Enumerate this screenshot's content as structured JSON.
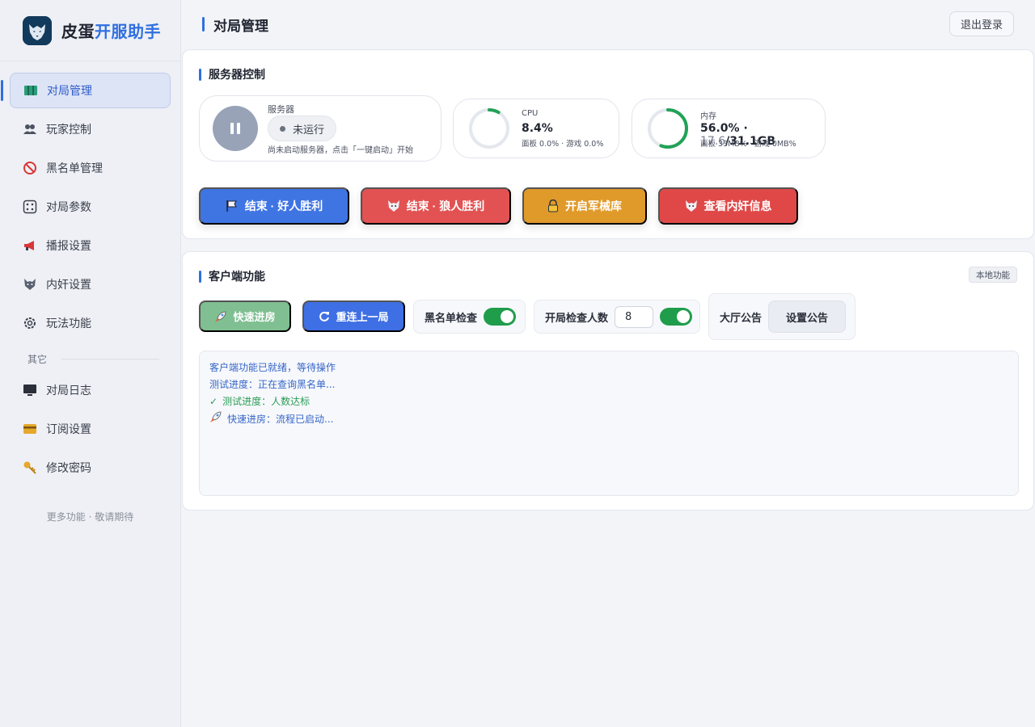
{
  "brand": {
    "name_prefix": "皮蛋",
    "name_accent": "开服助手",
    "logo_icon": "wolf-logo-icon"
  },
  "sidebar": {
    "items": [
      {
        "label": "对局管理",
        "icon": "map-icon",
        "active": true
      },
      {
        "label": "玩家控制",
        "icon": "users-icon",
        "active": false
      },
      {
        "label": "黑名单管理",
        "icon": "prohibited-icon",
        "active": false
      },
      {
        "label": "对局参数",
        "icon": "dice-icon",
        "active": false
      },
      {
        "label": "播报设置",
        "icon": "megaphone-icon",
        "active": false
      },
      {
        "label": "内奸设置",
        "icon": "wolf-icon",
        "active": false
      },
      {
        "label": "玩法功能",
        "icon": "gear-icon",
        "active": false
      }
    ],
    "group_label": "其它",
    "other_items": [
      {
        "label": "对局日志",
        "icon": "monitor-icon"
      },
      {
        "label": "订阅设置",
        "icon": "card-icon"
      },
      {
        "label": "修改密码",
        "icon": "key-icon"
      }
    ],
    "footer": "更多功能 · 敬请期待"
  },
  "header": {
    "title": "对局管理",
    "logout_label": "退出登录"
  },
  "server_panel": {
    "title": "服务器控制",
    "server_label": "服务器",
    "status": "未运行",
    "hint": "尚未启动服务器，点击「一键启动」开始",
    "cpu": {
      "label": "CPU",
      "value": "8.4%",
      "sub": "面板 0.0% · 游戏 0.0%",
      "fraction": 0.084
    },
    "memory": {
      "label": "内存",
      "value_percent": "56.0% · ",
      "value_used": "17.6",
      "value_total": "/31.1GB",
      "sub": "面板 33MB% · 游戏 0MB%",
      "fraction": 0.56
    },
    "actions": [
      {
        "label": "结束 · 好人胜利",
        "icon": "flag-icon"
      },
      {
        "label": "结束 · 狼人胜利",
        "icon": "wolf-icon"
      },
      {
        "label": "开启军械库",
        "icon": "lock-icon"
      },
      {
        "label": "查看内奸信息",
        "icon": "wolf-icon"
      }
    ]
  },
  "client_panel": {
    "title": "客户端功能",
    "badge": "本地功能",
    "quick_join_label": "快速进房",
    "reconnect_label": "重连上一局",
    "blacklist_check_label": "黑名单检查",
    "blacklist_check_on": true,
    "player_count_label": "开局检查人数",
    "player_count_value": "8",
    "player_count_on": true,
    "notice_label": "大厅公告",
    "notice_button": "设置公告",
    "logs": [
      {
        "text": "客户端功能已就绪，等待操作",
        "type": "info",
        "prefix": ""
      },
      {
        "text": "测试进度：正在查询黑名单...",
        "type": "info",
        "prefix": ""
      },
      {
        "text": "测试进度：人数达标",
        "type": "ok",
        "prefix": "✓"
      },
      {
        "text": "快速进房：流程已启动...",
        "type": "info",
        "prefix": "🚀"
      }
    ]
  },
  "colors": {
    "accent": "#2f6fe0",
    "success": "#1f9d4b",
    "danger": "#e25252",
    "warning": "#e09a2a"
  }
}
